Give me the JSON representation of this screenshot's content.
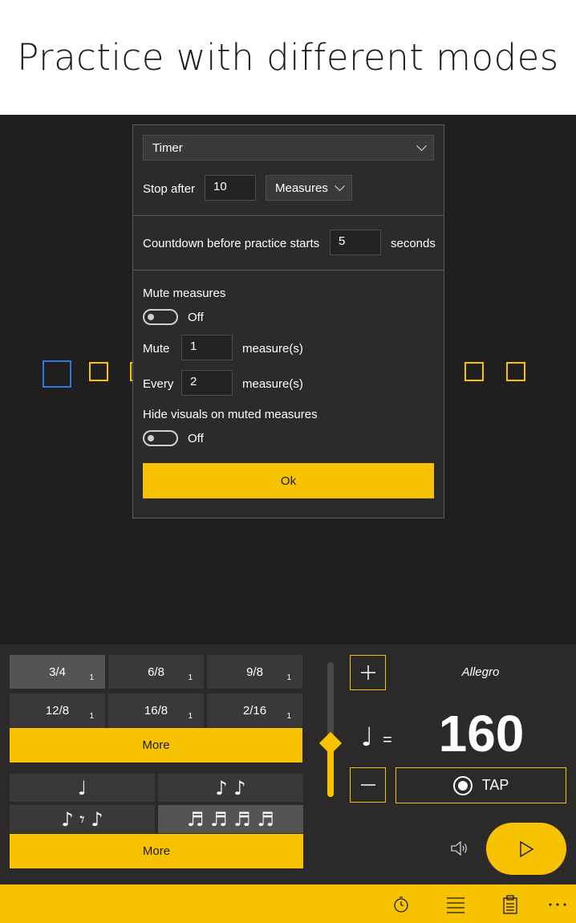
{
  "headline": "Practice with different modes",
  "dialog": {
    "mode_value": "Timer",
    "stop_after_label": "Stop after",
    "stop_after_value": "10",
    "stop_unit": "Measures",
    "countdown_label": "Countdown before practice starts",
    "countdown_value": "5",
    "countdown_unit": "seconds",
    "mute_measures_label": "Mute measures",
    "mute_toggle_state": "Off",
    "mute_label": "Mute",
    "mute_value": "1",
    "mute_unit": "measure(s)",
    "every_label": "Every",
    "every_value": "2",
    "every_unit": "measure(s)",
    "hide_visuals_label": "Hide visuals on muted measures",
    "hide_toggle_state": "Off",
    "ok_label": "Ok"
  },
  "time_signatures": [
    {
      "label": "3/4",
      "sub": "1",
      "selected": true
    },
    {
      "label": "6/8",
      "sub": "1",
      "selected": false
    },
    {
      "label": "9/8",
      "sub": "1",
      "selected": false
    },
    {
      "label": "12/8",
      "sub": "1",
      "selected": false
    },
    {
      "label": "16/8",
      "sub": "1",
      "selected": false
    },
    {
      "label": "2/16",
      "sub": "1",
      "selected": false
    }
  ],
  "more_label_1": "More",
  "subdivisions": [
    {
      "glyph": "♩",
      "selected": false
    },
    {
      "glyph": "♪ ♪",
      "selected": false
    },
    {
      "glyph": "♪ 𝄾 ♪",
      "selected": false
    },
    {
      "glyph": "♬ ♬ ♬ ♬",
      "selected": true
    }
  ],
  "more_label_2": "More",
  "tempo": {
    "name": "Allegro",
    "bpm": "160",
    "note_glyph": "♩",
    "equals": "=",
    "tap_label": "TAP",
    "plus_symbol": "+",
    "minus_symbol": "—",
    "slider_level": 0.4
  },
  "beats": {
    "count": 6,
    "active_index": 0
  },
  "colors": {
    "accent": "#f7c200",
    "active_beat": "#2a7ae2",
    "background": "#211e1e"
  },
  "icons": [
    "timer-icon",
    "list-icon",
    "clipboard-icon",
    "more-icon",
    "volume-icon",
    "play-icon"
  ]
}
